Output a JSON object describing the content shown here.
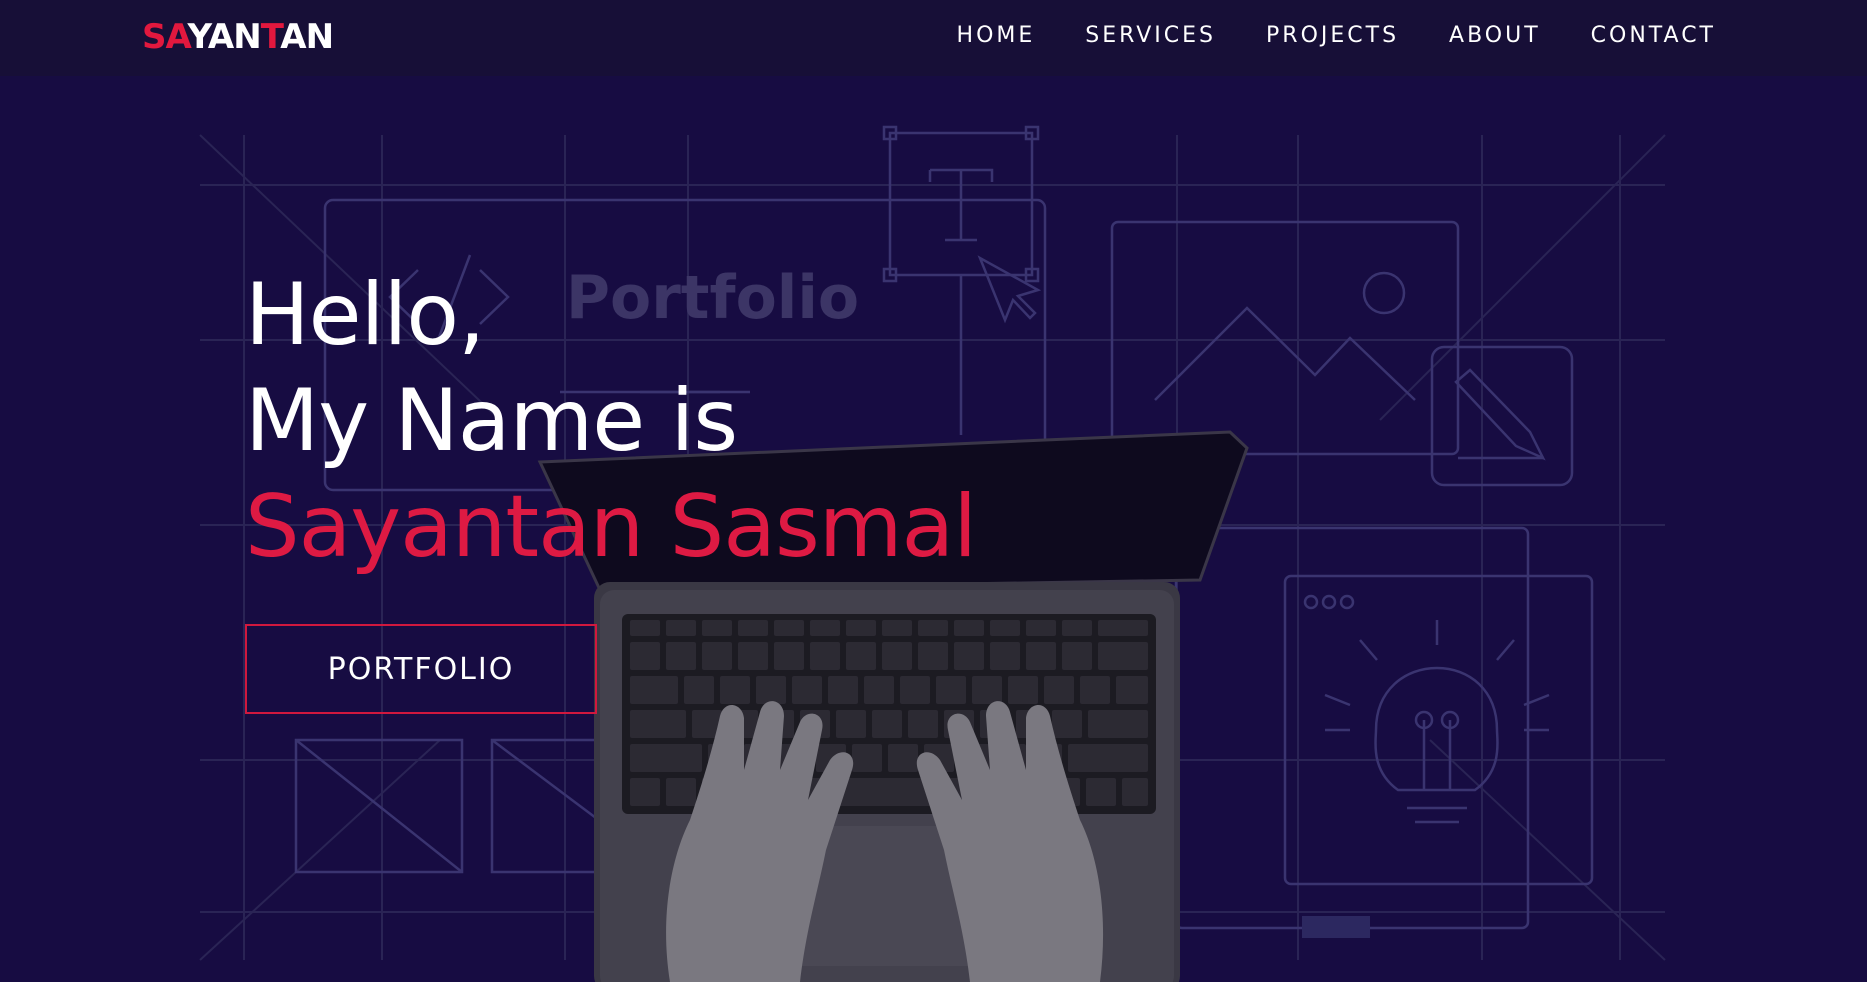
{
  "navbar": {
    "logo_parts": [
      "SA",
      "YAN",
      "T",
      "AN"
    ],
    "links": [
      "HOME",
      "SERVICES",
      "PROJECTS",
      "ABOUT",
      "CONTACT"
    ]
  },
  "hero": {
    "line1": "Hello,",
    "line2": "My Name is",
    "name": "Sayantan Sasmal",
    "button_label": "PORTFOLIO",
    "background_watermark": "Portfolio"
  },
  "colors": {
    "background": "#170c42",
    "navbar": "#170f37",
    "accent": "#de1a43",
    "text": "#ffffff"
  },
  "icons": [
    "text-tool-icon",
    "cursor-icon",
    "image-icon",
    "pencil-icon",
    "lightbulb-icon",
    "code-icon",
    "laptop-image"
  ]
}
